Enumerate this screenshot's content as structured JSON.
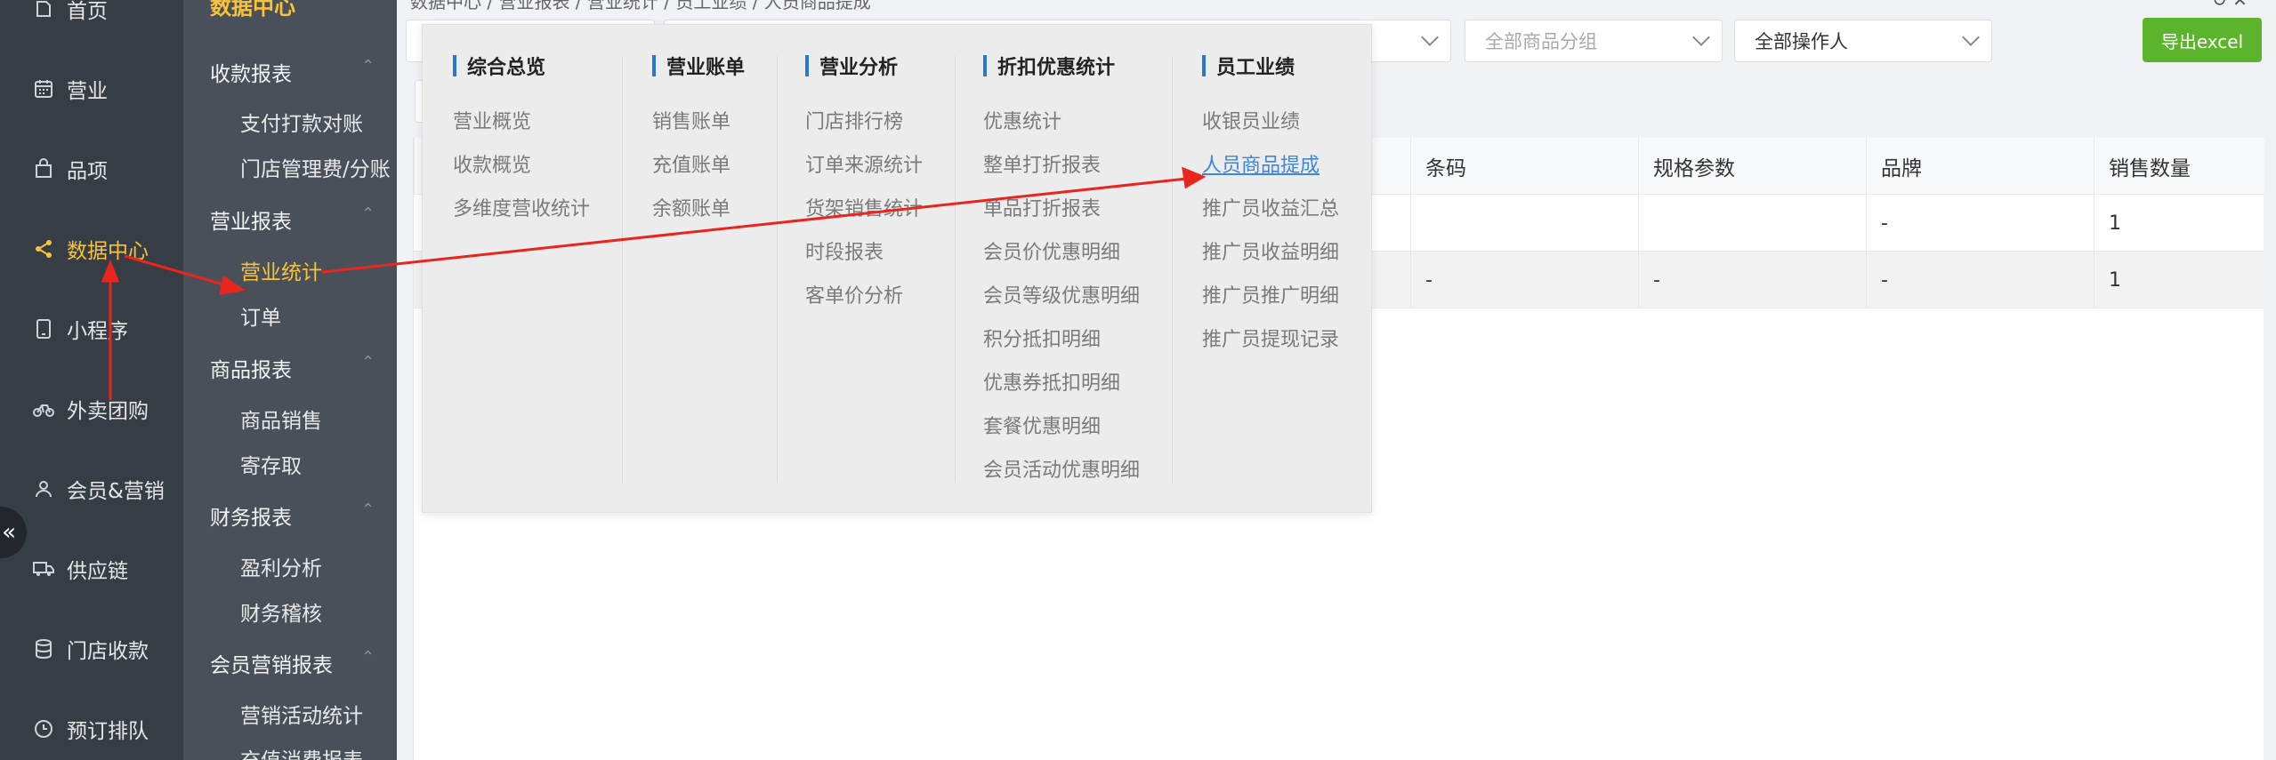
{
  "nav": {
    "items": [
      {
        "label": "首页",
        "icon": "home-icon"
      },
      {
        "label": "营业",
        "icon": "calendar-icon"
      },
      {
        "label": "品项",
        "icon": "bag-icon"
      },
      {
        "label": "数据中心",
        "icon": "share-icon"
      },
      {
        "label": "小程序",
        "icon": "phone-icon"
      },
      {
        "label": "外卖团购",
        "icon": "bike-icon"
      },
      {
        "label": "会员&营销",
        "icon": "user-icon"
      },
      {
        "label": "供应链",
        "icon": "truck-icon"
      },
      {
        "label": "门店收款",
        "icon": "database-icon"
      },
      {
        "label": "预订排队",
        "icon": "clock-icon"
      }
    ],
    "collapse_glyph": "«"
  },
  "subnav": {
    "head": "数据中心",
    "sections": [
      {
        "title": "收款报表",
        "items": [
          "支付打款对账",
          "门店管理费/分账"
        ]
      },
      {
        "title": "营业报表",
        "items": [
          "营业统计",
          "订单"
        ]
      },
      {
        "title": "商品报表",
        "items": [
          "商品销售",
          "寄存取"
        ]
      },
      {
        "title": "财务报表",
        "items": [
          "盈利分析",
          "财务稽核"
        ]
      },
      {
        "title": "会员营销报表",
        "items": [
          "营销活动统计",
          "充值消费报表"
        ]
      }
    ],
    "caret": "⌃"
  },
  "main": {
    "breadcrumb": "数据中心  /  营业报表  /  营业统计  /  员工业绩  /  人员商品提成",
    "filters": {
      "group": "全部商品分组",
      "operator": "全部操作人"
    },
    "export_label": "导出excel",
    "top_icons": "↻  ✕",
    "table": {
      "headers": [
        "条码",
        "规格参数",
        "品牌",
        "销售数量"
      ],
      "rows": [
        [
          "",
          "",
          "-",
          "1"
        ],
        [
          "-",
          "-",
          "-",
          "1"
        ]
      ]
    }
  },
  "mega_menu": {
    "columns": [
      {
        "title": "综合总览",
        "items": [
          "营业概览",
          "收款概览",
          "多维度营收统计"
        ]
      },
      {
        "title": "营业账单",
        "items": [
          "销售账单",
          "充值账单",
          "余额账单"
        ]
      },
      {
        "title": "营业分析",
        "items": [
          "门店排行榜",
          "订单来源统计",
          "货架销售统计",
          "时段报表",
          "客单价分析"
        ]
      },
      {
        "title": "折扣优惠统计",
        "items": [
          "优惠统计",
          "整单打折报表",
          "单品打折报表",
          "会员价优惠明细",
          "会员等级优惠明细",
          "积分抵扣明细",
          "优惠券抵扣明细",
          "套餐优惠明细",
          "会员活动优惠明细"
        ]
      },
      {
        "title": "员工业绩",
        "items": [
          "收银员业绩",
          "人员商品提成",
          "推广员收益汇总",
          "推广员收益明细",
          "推广员推广明细",
          "推广员提现记录"
        ]
      }
    ]
  },
  "colors": {
    "nav_bg": "#373d45",
    "subnav_bg": "#4a5059",
    "accent": "#f7c33c",
    "export_green": "#5cb42c",
    "link_blue": "#3b86e0",
    "arrow_red": "#e8261e"
  }
}
